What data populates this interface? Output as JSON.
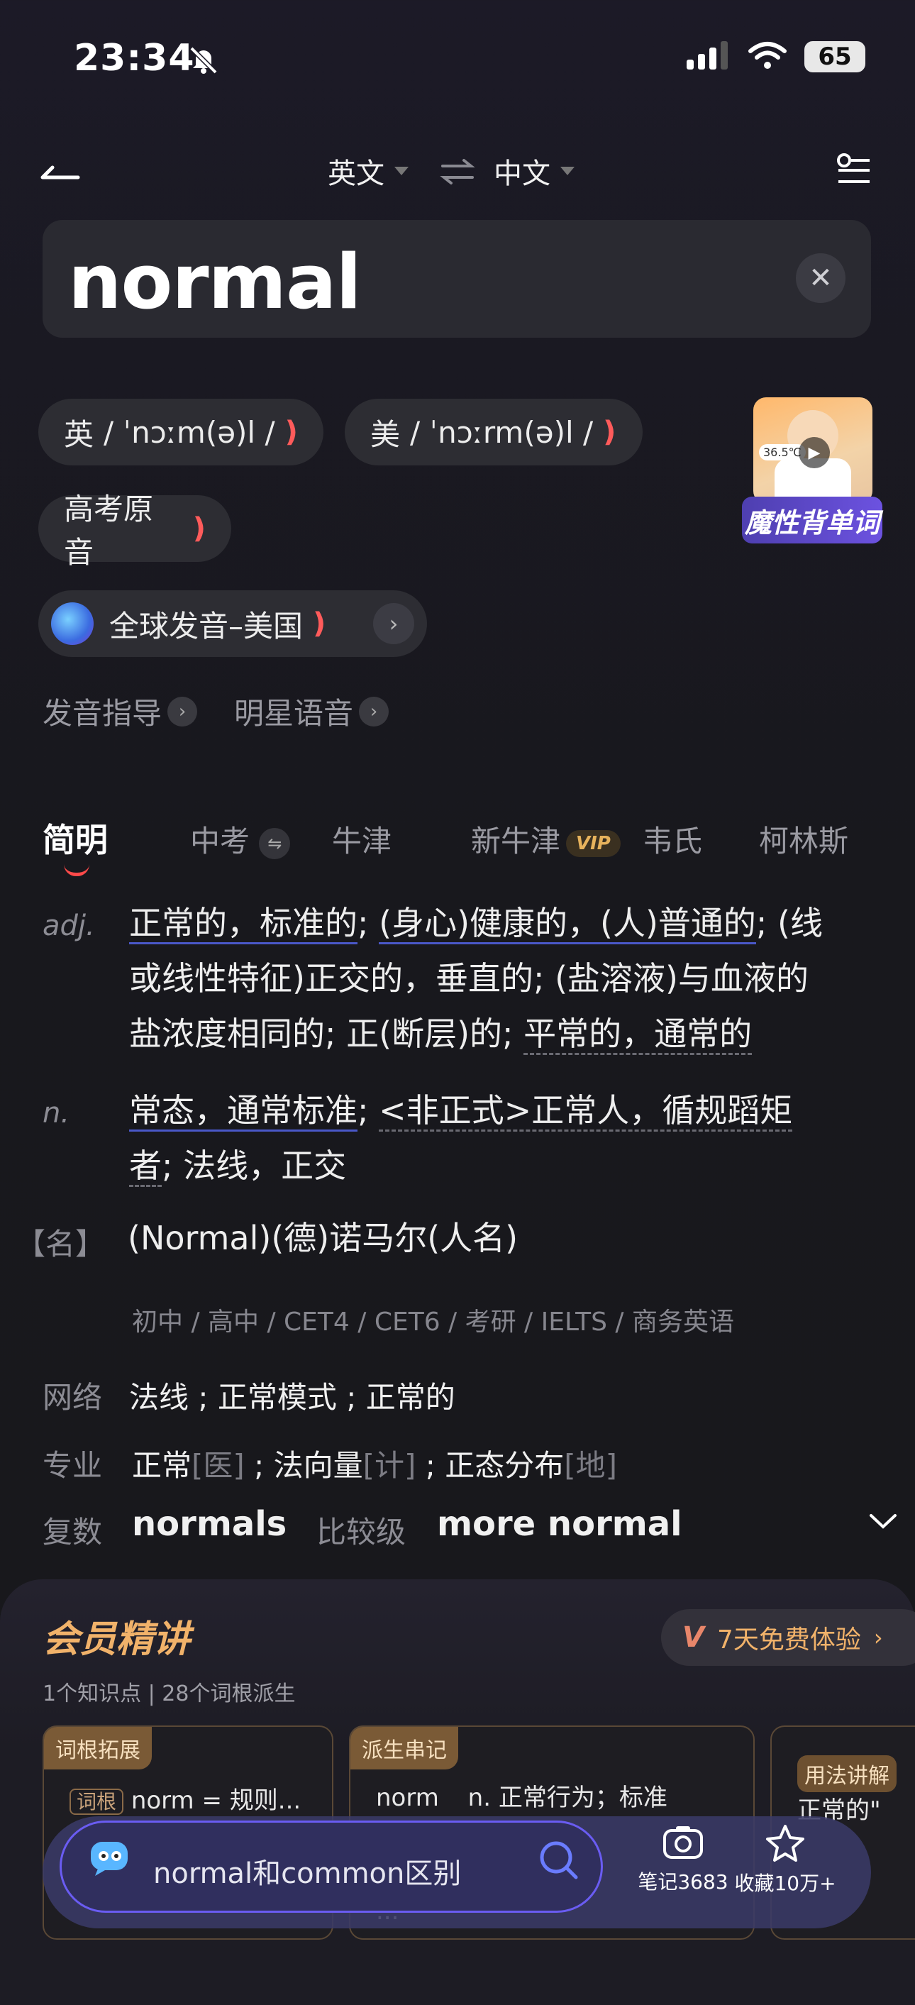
{
  "status_bar": {
    "time": "23:34",
    "battery": "65"
  },
  "header": {
    "source_lang": "英文",
    "target_lang": "中文"
  },
  "search": {
    "query": "normal"
  },
  "pronunciation": {
    "uk": {
      "label": "英",
      "ipa": "/ ˈnɔːm(ə)l /"
    },
    "us": {
      "label": "美",
      "ipa": "/ ˈnɔːrm(ə)l /"
    },
    "gaokao": "高考原音",
    "global": "全球发音–美国",
    "guide": "发音指导",
    "star_voice": "明星语音"
  },
  "promo": {
    "label": "魔性背单词",
    "temp": "36.5℃"
  },
  "tabs": [
    "简明",
    "中考",
    "牛津",
    "新牛津",
    "韦氏",
    "柯林斯"
  ],
  "vip_badge": "VIP",
  "definitions": {
    "adj_pos": "adj.",
    "adj_l1_a": "正常的，标准的",
    "adj_l1_b": "; ",
    "adj_l1_c": "(身心)健康的，(人)普通的",
    "adj_l1_d": "; (线",
    "adj_l2": "或线性特征)正交的，垂直的; (盐溶液)与血液的",
    "adj_l3_a": "盐浓度相同的; 正(断层)的; ",
    "adj_l3_b": "平常的，通常的",
    "n_pos": "n.",
    "n_l1_a": "常态，通常标准",
    "n_l1_b": "; ",
    "n_l1_c": "<非正式>正常人，循规蹈矩",
    "n_l2_a": "者",
    "n_l2_b": "; 法线，正交",
    "name_pos": "【名】",
    "name_def": "(Normal)(德)诺马尔(人名)",
    "levels": "初中 / 高中 / CET4 / CET6 / 考研 / IELTS / 商务英语"
  },
  "extra": {
    "web_label": "网络",
    "web_value": "法线 ; 正常模式 ; 正常的",
    "pro_label": "专业",
    "pro_v1": "正常",
    "pro_t1": "[医]",
    "pro_v2": " ; 法向量",
    "pro_t2": "[计]",
    "pro_v3": " ; 正态分布",
    "pro_t3": "[地]",
    "plural_label": "复数",
    "plural_value": "normals",
    "comp_label": "比较级",
    "comp_value": "more normal"
  },
  "member": {
    "title": "会员精讲",
    "subtitle": "1个知识点 | 28个词根派生",
    "trial": "7天免费体验",
    "card1_tag": "词根拓展",
    "card1_chip": "词根",
    "card1_text": "norm = 规则...",
    "card2_tag": "派生串记",
    "card2_word": "norm",
    "card2_def": "n. 正常行为；标准",
    "card2_more": "...",
    "card3_tag": "用法讲解",
    "card3_text": "正常的\""
  },
  "bottom_bar": {
    "query": "normal和common区别",
    "notes": "笔记3683",
    "fav": "收藏10万+"
  },
  "colors": {
    "accent_red": "#ff5b5b",
    "accent_gold": "#f1b26a",
    "accent_purple": "#6a5cf2"
  }
}
